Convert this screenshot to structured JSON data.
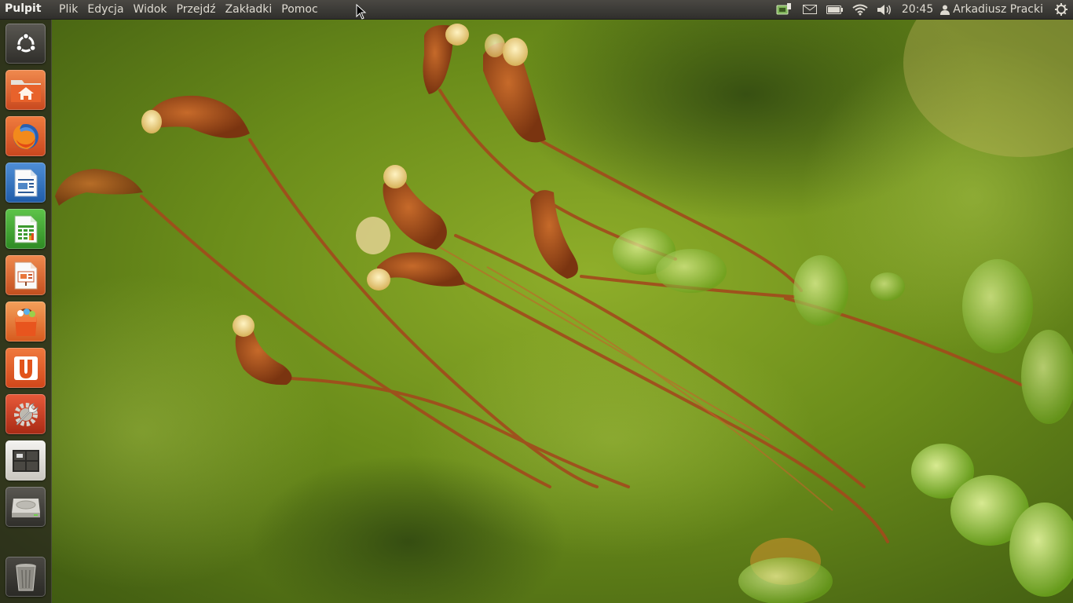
{
  "panel": {
    "app_name": "Pulpit",
    "menus": [
      "Plik",
      "Edycja",
      "Widok",
      "Przejdź",
      "Zakładki",
      "Pomoc"
    ],
    "indicators": [
      "network-printer-icon",
      "mail-icon",
      "battery-icon",
      "wifi-icon",
      "volume-icon"
    ],
    "clock": "20:45",
    "user": "Arkadiusz Pracki",
    "session_icon": "gear-power-icon"
  },
  "launcher": {
    "items": [
      {
        "name": "dash-home",
        "icon": "ubuntu-logo-icon"
      },
      {
        "name": "home-folder",
        "icon": "home-folder-icon"
      },
      {
        "name": "firefox",
        "icon": "firefox-icon"
      },
      {
        "name": "libreoffice-writer",
        "icon": "writer-icon"
      },
      {
        "name": "libreoffice-calc",
        "icon": "calc-icon"
      },
      {
        "name": "libreoffice-impress",
        "icon": "impress-icon"
      },
      {
        "name": "software-center",
        "icon": "shopping-bag-icon"
      },
      {
        "name": "ubuntu-one",
        "icon": "ubuntu-one-icon"
      },
      {
        "name": "system-settings",
        "icon": "settings-wrench-icon"
      },
      {
        "name": "workspace-switcher",
        "icon": "workspaces-icon"
      },
      {
        "name": "drive",
        "icon": "hard-drive-icon"
      },
      {
        "name": "trash",
        "icon": "trash-icon"
      }
    ]
  },
  "colors": {
    "panel_bg": "#3c3b37",
    "wallpaper_green": "#6f8f1c",
    "stalk_orange": "#a2481a"
  }
}
